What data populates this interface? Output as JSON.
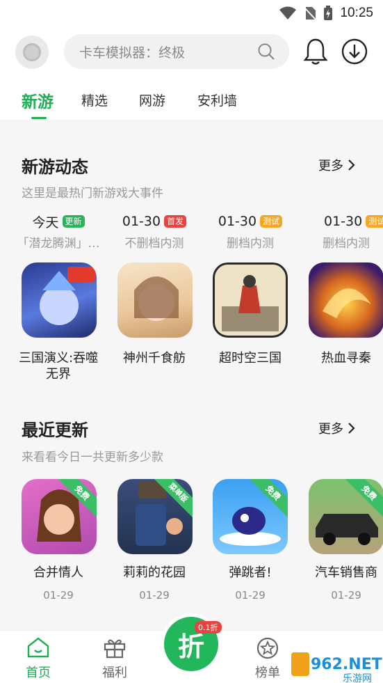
{
  "status": {
    "time": "10:25"
  },
  "search": {
    "placeholder": "卡车模拟器：终极"
  },
  "tabs": [
    {
      "label": "新游",
      "active": true
    },
    {
      "label": "精选"
    },
    {
      "label": "网游"
    },
    {
      "label": "安利墙"
    }
  ],
  "new_games_section": {
    "title": "新游动态",
    "subtitle": "这里是最热门新游戏大事件",
    "more_label": "更多",
    "items": [
      {
        "date": "今天",
        "badge": "更新",
        "badge_color": "#29b35a",
        "desc": "「潜龙腾渊」…",
        "name": "三国演义:吞噬无界",
        "icon": "game-icon-sanguo"
      },
      {
        "date": "01-30",
        "badge": "首发",
        "badge_color": "#e8433f",
        "desc": "不删档内测",
        "name": "神州千食舫",
        "icon": "game-icon-shenzhou"
      },
      {
        "date": "01-30",
        "badge": "测试",
        "badge_color": "#f5a623",
        "desc": "删档内测",
        "name": "超时空三国",
        "icon": "game-icon-chaoshikong"
      },
      {
        "date": "01-30",
        "badge": "测试",
        "badge_color": "#f5a623",
        "desc": "删档内测",
        "name": "热血寻秦",
        "icon": "game-icon-rexue"
      }
    ]
  },
  "recent_updates_section": {
    "title": "最近更新",
    "subtitle": "来看看今日一共更新多少款",
    "more_label": "更多",
    "items": [
      {
        "ribbon": "免费",
        "name": "合并情人",
        "date": "01-29",
        "icon": "game-icon-hebing"
      },
      {
        "ribbon": "菜单版",
        "name": "莉莉的花园",
        "date": "01-29",
        "icon": "game-icon-lili"
      },
      {
        "ribbon": "免费",
        "name": "弹跳者!",
        "date": "01-29",
        "icon": "game-icon-tantiao"
      },
      {
        "ribbon": "免费",
        "name": "汽车销售商",
        "date": "01-29",
        "icon": "game-icon-qiche"
      }
    ]
  },
  "bottom_nav": {
    "items": [
      {
        "label": "首页",
        "icon": "home-icon",
        "active": true
      },
      {
        "label": "福利",
        "icon": "gift-icon"
      },
      {
        "label": "折",
        "icon": "discount-icon",
        "badge": "0.1折"
      },
      {
        "label": "榜单",
        "icon": "ranking-icon"
      }
    ]
  },
  "watermark": {
    "text": "962.NET",
    "sub": "乐游网"
  },
  "colors": {
    "accent": "#1fae53"
  }
}
